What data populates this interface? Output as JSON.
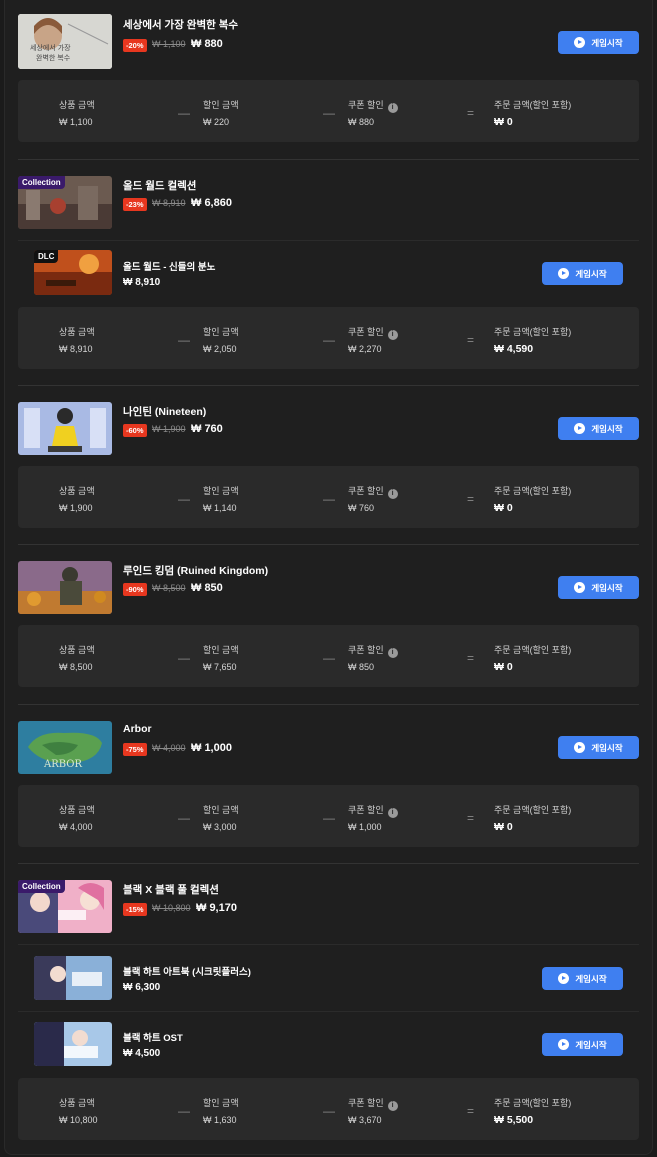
{
  "buttons": {
    "play_label": "게임시작"
  },
  "summary_labels": {
    "product": "상품 금액",
    "discount": "할인 금액",
    "coupon": "쿠폰 할인",
    "order": "주문 금액(할인 포함)"
  },
  "colors": {
    "accent": "#3f7ff0",
    "discount_badge": "#e7371f",
    "collection_badge": "#3a1a6a"
  },
  "orders": [
    {
      "title": "세상에서 가장 완벽한 복수",
      "discount": "-20%",
      "original": "₩ 1,100",
      "price": "₩ 880",
      "summary": {
        "product": "₩ 1,100",
        "discount": "₩ 220",
        "coupon": "₩ 880",
        "order": "₩ 0"
      }
    },
    {
      "title": "올드 월드 컬렉션",
      "badge": "Collection",
      "discount": "-23%",
      "original": "₩ 8,910",
      "price": "₩ 6,860",
      "items": [
        {
          "title": "올드 월드 - 신들의 분노",
          "badge": "DLC",
          "price": "₩ 8,910"
        }
      ],
      "summary": {
        "product": "₩ 8,910",
        "discount": "₩ 2,050",
        "coupon": "₩ 2,270",
        "order": "₩ 4,590"
      }
    },
    {
      "title": "나인틴 (Nineteen)",
      "discount": "-60%",
      "original": "₩ 1,900",
      "price": "₩ 760",
      "summary": {
        "product": "₩ 1,900",
        "discount": "₩ 1,140",
        "coupon": "₩ 760",
        "order": "₩ 0"
      }
    },
    {
      "title": "루인드 킹덤 (Ruined Kingdom)",
      "discount": "-90%",
      "original": "₩ 8,500",
      "price": "₩ 850",
      "summary": {
        "product": "₩ 8,500",
        "discount": "₩ 7,650",
        "coupon": "₩ 850",
        "order": "₩ 0"
      }
    },
    {
      "title": "Arbor",
      "thumb_text": "ARBOR",
      "discount": "-75%",
      "original": "₩ 4,000",
      "price": "₩ 1,000",
      "summary": {
        "product": "₩ 4,000",
        "discount": "₩ 3,000",
        "coupon": "₩ 1,000",
        "order": "₩ 0"
      }
    },
    {
      "title": "블랙 X 블랙 풀 컬렉션",
      "badge": "Collection",
      "discount": "-15%",
      "original": "₩ 10,800",
      "price": "₩ 9,170",
      "items": [
        {
          "title": "블랙 하트 아트북 (시크릿플러스)",
          "price": "₩ 6,300"
        },
        {
          "title": "블랙 하트 OST",
          "price": "₩ 4,500"
        }
      ],
      "summary": {
        "product": "₩ 10,800",
        "discount": "₩ 1,630",
        "coupon": "₩ 3,670",
        "order": "₩ 5,500"
      }
    }
  ]
}
